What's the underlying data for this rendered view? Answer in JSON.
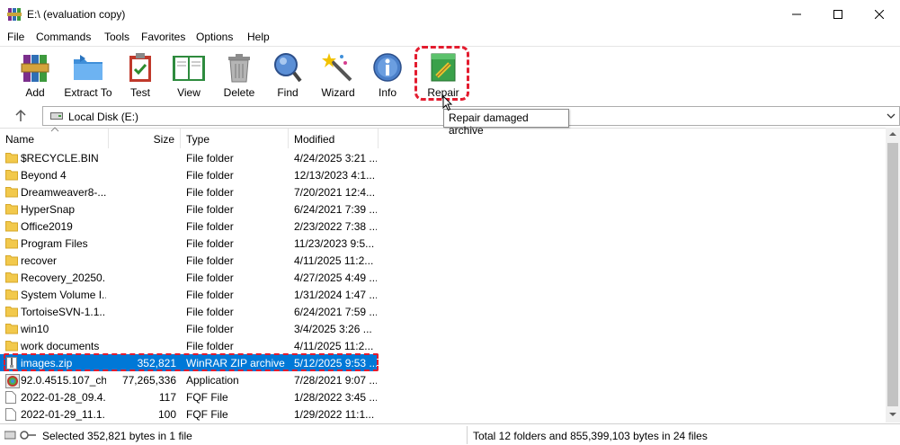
{
  "window": {
    "title": "E:\\ (evaluation copy)"
  },
  "menu": [
    "File",
    "Commands",
    "Tools",
    "Favorites",
    "Options",
    "Help"
  ],
  "toolbar": [
    {
      "label": "Add",
      "icon": "add-archive-icon"
    },
    {
      "label": "Extract To",
      "icon": "extract-folder-icon"
    },
    {
      "label": "Test",
      "icon": "test-clipboard-icon"
    },
    {
      "label": "View",
      "icon": "view-book-icon"
    },
    {
      "label": "Delete",
      "icon": "trash-icon"
    },
    {
      "label": "Find",
      "icon": "magnifier-icon"
    },
    {
      "label": "Wizard",
      "icon": "wand-icon"
    },
    {
      "label": "Info",
      "icon": "info-icon"
    },
    {
      "label": "Repair",
      "icon": "repair-kit-icon"
    }
  ],
  "tooltip": "Repair damaged archive",
  "address": {
    "path": "Local Disk (E:)"
  },
  "columns": {
    "name": "Name",
    "size": "Size",
    "type": "Type",
    "modified": "Modified"
  },
  "rows": [
    {
      "name": "$RECYCLE.BIN",
      "size": "",
      "type": "File folder",
      "modified": "4/24/2025 3:21 ...",
      "icon": "folder"
    },
    {
      "name": "Beyond 4",
      "size": "",
      "type": "File folder",
      "modified": "12/13/2023 4:1...",
      "icon": "folder"
    },
    {
      "name": "Dreamweaver8-...",
      "size": "",
      "type": "File folder",
      "modified": "7/20/2021 12:4...",
      "icon": "folder"
    },
    {
      "name": "HyperSnap",
      "size": "",
      "type": "File folder",
      "modified": "6/24/2021 7:39 ...",
      "icon": "folder"
    },
    {
      "name": "Office2019",
      "size": "",
      "type": "File folder",
      "modified": "2/23/2022 7:38 ...",
      "icon": "folder"
    },
    {
      "name": "Program Files",
      "size": "",
      "type": "File folder",
      "modified": "11/23/2023 9:5...",
      "icon": "folder"
    },
    {
      "name": "recover",
      "size": "",
      "type": "File folder",
      "modified": "4/11/2025 11:2...",
      "icon": "folder"
    },
    {
      "name": "Recovery_20250...",
      "size": "",
      "type": "File folder",
      "modified": "4/27/2025 4:49 ...",
      "icon": "folder"
    },
    {
      "name": "System Volume I...",
      "size": "",
      "type": "File folder",
      "modified": "1/31/2024 1:47 ...",
      "icon": "folder"
    },
    {
      "name": "TortoiseSVN-1.1...",
      "size": "",
      "type": "File folder",
      "modified": "6/24/2021 7:59 ...",
      "icon": "folder"
    },
    {
      "name": "win10",
      "size": "",
      "type": "File folder",
      "modified": "3/4/2025 3:26 ...",
      "icon": "folder"
    },
    {
      "name": "work documents",
      "size": "",
      "type": "File folder",
      "modified": "4/11/2025 11:2...",
      "icon": "folder"
    },
    {
      "name": "images.zip",
      "size": "352,821",
      "type": "WinRAR ZIP archive",
      "modified": "5/12/2025 9:53 ...",
      "icon": "zip",
      "selected": true
    },
    {
      "name": "92.0.4515.107_ch...",
      "size": "77,265,336",
      "type": "Application",
      "modified": "7/28/2021 9:07 ...",
      "icon": "app"
    },
    {
      "name": "2022-01-28_09.4...",
      "size": "117",
      "type": "FQF File",
      "modified": "1/28/2022 3:45 ...",
      "icon": "file"
    },
    {
      "name": "2022-01-29_11.1...",
      "size": "100",
      "type": "FQF File",
      "modified": "1/29/2022 11:1...",
      "icon": "file"
    }
  ],
  "status": {
    "left": "Selected 352,821 bytes in 1 file",
    "right": "Total 12 folders and 855,399,103 bytes in 24 files"
  }
}
